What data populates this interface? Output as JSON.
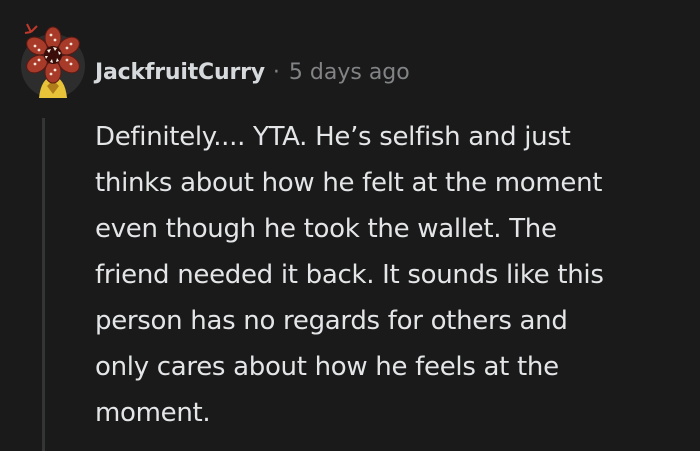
{
  "comment": {
    "username": "JackfruitCurry",
    "separator": "·",
    "timestamp": "5 days ago",
    "avatar_icon": "demogorgon-avatar-icon",
    "body_lines": [
      "Definitely.... YTA. He’s selfish and just",
      "thinks about how he felt at the moment",
      "even though he took the wallet. The",
      "friend needed it back. It sounds like this",
      "person has no regards for others and",
      "only cares about how he feels at the",
      "moment."
    ]
  },
  "colors": {
    "background": "#1a1a1b",
    "username": "#d7dadc",
    "meta": "#818384",
    "body": "#e3e5e7",
    "thread_line": "#343536",
    "avatar_bg": "#2d2d2e",
    "avatar_petal": "#a83a2a",
    "avatar_body": "#e8c33a"
  }
}
